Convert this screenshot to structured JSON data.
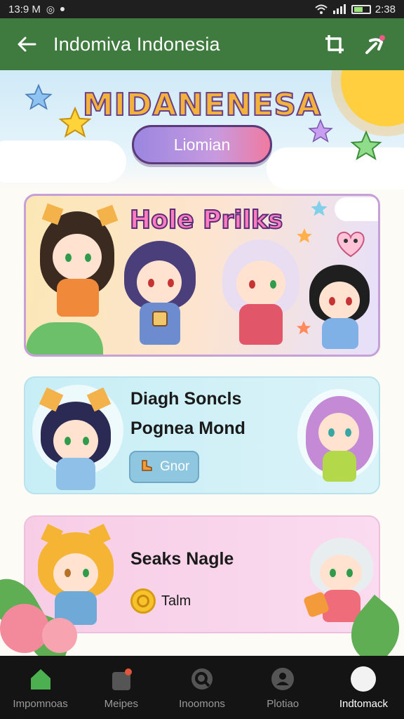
{
  "status_bar": {
    "time": "13:9 M",
    "right_time": "2:38"
  },
  "app_bar": {
    "title": "Indomiva Indonesia",
    "back_icon": "arrow-left-icon",
    "actions": [
      "crop-icon",
      "share-icon"
    ]
  },
  "hero": {
    "title": "MIDANENESA",
    "pill_label": "Liomian"
  },
  "banner": {
    "title": "Hole Prilks"
  },
  "cards": [
    {
      "line1": "Diagh Soncls",
      "line2": "Pognea Mond",
      "chip_label": "Gnor"
    },
    {
      "line1": "Seaks Nagle",
      "chip_label": "Talm"
    }
  ],
  "bottom_nav": [
    {
      "label": "Impomnoas",
      "icon": "home-icon",
      "active": false
    },
    {
      "label": "Meipes",
      "icon": "bag-icon",
      "active": false
    },
    {
      "label": "Inoomons",
      "icon": "search-icon",
      "active": false
    },
    {
      "label": "Plotiao",
      "icon": "profile-icon",
      "active": false
    },
    {
      "label": "Indtomack",
      "icon": "circle-icon",
      "active": true
    }
  ],
  "colors": {
    "app_bar": "#3f7a3e",
    "nav_bg": "#141414",
    "home_icon": "#4caf50"
  }
}
